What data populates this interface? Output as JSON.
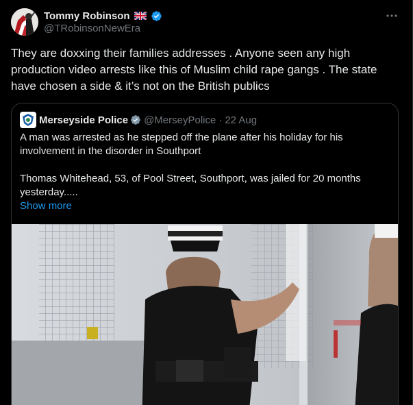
{
  "post": {
    "author": {
      "display_name": "Tommy Robinson",
      "flag": "uk-flag",
      "verified": true,
      "handle": "@TRobinsonNewEra"
    },
    "text": "They are doxxing their families addresses . Anyone seen any high production video arrests like this of Muslim child rape gangs . The state have chosen a side & it’s not on the British publics",
    "quote": {
      "author": {
        "display_name": "Merseyside Police",
        "verified": true,
        "handle": "@MerseyPolice",
        "separator": "·",
        "date": "22 Aug"
      },
      "paragraph_1": "A man was arrested as he stepped off the plane after his holiday for his involvement in the disorder in Southport",
      "paragraph_2": "Thomas Whitehead, 53, of Pool Street, Southport, was jailed for 20 months yesterday.....",
      "show_more": "Show more",
      "media": {
        "icon": "video-still-image",
        "description_hidden": true
      }
    }
  },
  "colors": {
    "background": "#000000",
    "text": "#e7e9ea",
    "muted": "#71767b",
    "link": "#1d9bf0",
    "border": "#2f3336",
    "verified_blue": "#1d9bf0",
    "verified_gray": "#829aab"
  }
}
